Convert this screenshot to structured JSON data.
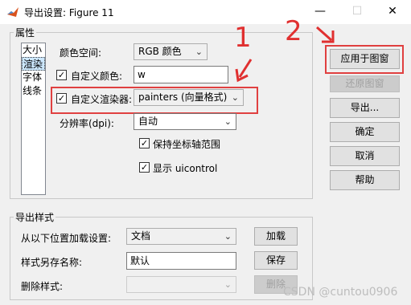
{
  "window": {
    "title": "导出设置: Figure 11",
    "minimize_glyph": "—",
    "maximize_glyph": "☐",
    "close_glyph": "✕"
  },
  "properties_group": {
    "label": "属性",
    "list_items": [
      "大小",
      "渲染",
      "字体",
      "线条"
    ],
    "selected_index": 1,
    "color_space": {
      "label": "颜色空间:",
      "value": "RGB 颜色"
    },
    "custom_color": {
      "label": "自定义颜色:",
      "checked": true,
      "value": "w"
    },
    "custom_renderer": {
      "label": "自定义渲染器:",
      "checked": true,
      "value": "painters (向量格式)"
    },
    "resolution": {
      "label": "分辨率(dpi):",
      "value": "自动"
    },
    "keep_axes_limits": {
      "label": "保持坐标轴范围",
      "checked": true
    },
    "show_uicontrol": {
      "label": "显示 uicontrol",
      "checked": true
    }
  },
  "export_styles_group": {
    "label": "导出样式",
    "load_row": {
      "label": "从以下位置加载设置:",
      "value": "文档",
      "button": "加载"
    },
    "save_row": {
      "label": "样式另存名称:",
      "value": "默认",
      "button": "保存"
    },
    "delete_row": {
      "label": "删除样式:",
      "value": "",
      "button": "删除"
    }
  },
  "side_buttons": {
    "apply": "应用于图窗",
    "restore": "还原图窗",
    "export": "导出...",
    "ok": "确定",
    "cancel": "取消",
    "help": "帮助"
  },
  "annotations": {
    "label_1": "1",
    "label_2": "2",
    "color": "#e03030"
  },
  "watermark": "CSDN @cuntou0906"
}
